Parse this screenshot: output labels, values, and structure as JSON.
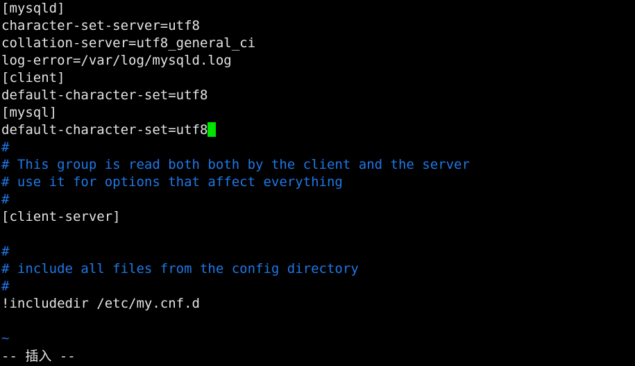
{
  "terminal": {
    "app": "vim",
    "background_color": "#000000",
    "foreground_color": "#e4e4e4",
    "comment_color": "#1f78e8",
    "cursor_color": "#00e500",
    "file_type": "my.cnf",
    "lines": [
      {
        "text": "[mysqld]",
        "style": "white"
      },
      {
        "text": "character-set-server=utf8",
        "style": "white"
      },
      {
        "text": "collation-server=utf8_general_ci",
        "style": "white"
      },
      {
        "text": "log-error=/var/log/mysqld.log",
        "style": "white"
      },
      {
        "text": "[client]",
        "style": "white"
      },
      {
        "text": "default-character-set=utf8",
        "style": "white"
      },
      {
        "text": "[mysql]",
        "style": "white"
      },
      {
        "text": "default-character-set=utf8",
        "style": "white",
        "cursor": true
      },
      {
        "text": "#",
        "style": "blue"
      },
      {
        "text": "# This group is read both both by the client and the server",
        "style": "blue"
      },
      {
        "text": "# use it for options that affect everything",
        "style": "blue"
      },
      {
        "text": "#",
        "style": "blue"
      },
      {
        "text": "[client-server]",
        "style": "white"
      },
      {
        "text": "",
        "style": "blank"
      },
      {
        "text": "#",
        "style": "blue"
      },
      {
        "text": "# include all files from the config directory",
        "style": "blue"
      },
      {
        "text": "#",
        "style": "blue"
      },
      {
        "text": "!includedir /etc/my.cnf.d",
        "style": "white"
      },
      {
        "text": "",
        "style": "blank"
      },
      {
        "text": "~",
        "style": "nontext"
      }
    ],
    "status_line": "-- 插入 --"
  }
}
